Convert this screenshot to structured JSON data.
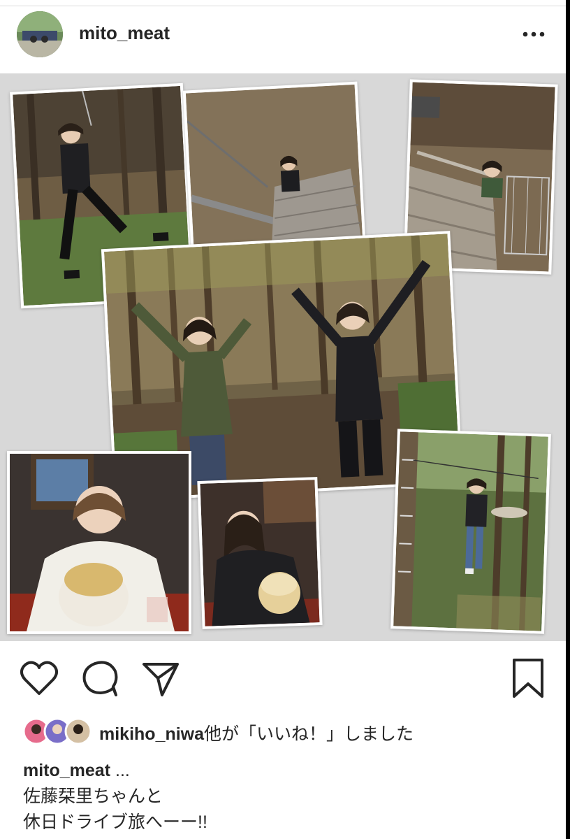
{
  "post": {
    "username": "mito_meat",
    "more_icon": "more-horizontal-icon"
  },
  "actions": {
    "like_icon": "heart-icon",
    "comment_icon": "comment-icon",
    "share_icon": "send-icon",
    "save_icon": "bookmark-icon"
  },
  "likes": {
    "user": "mikiho_niwa",
    "suffix": "他が「いいね！」しました"
  },
  "caption": {
    "username": "mito_meat",
    "more": " ...",
    "line1": "佐藤栞里ちゃんと",
    "line2": "休日ドライブ旅へーー!!"
  },
  "colors": {
    "text": "#262626",
    "photo_bg": "#d8d8d8",
    "divider": "#dbdbdb"
  }
}
